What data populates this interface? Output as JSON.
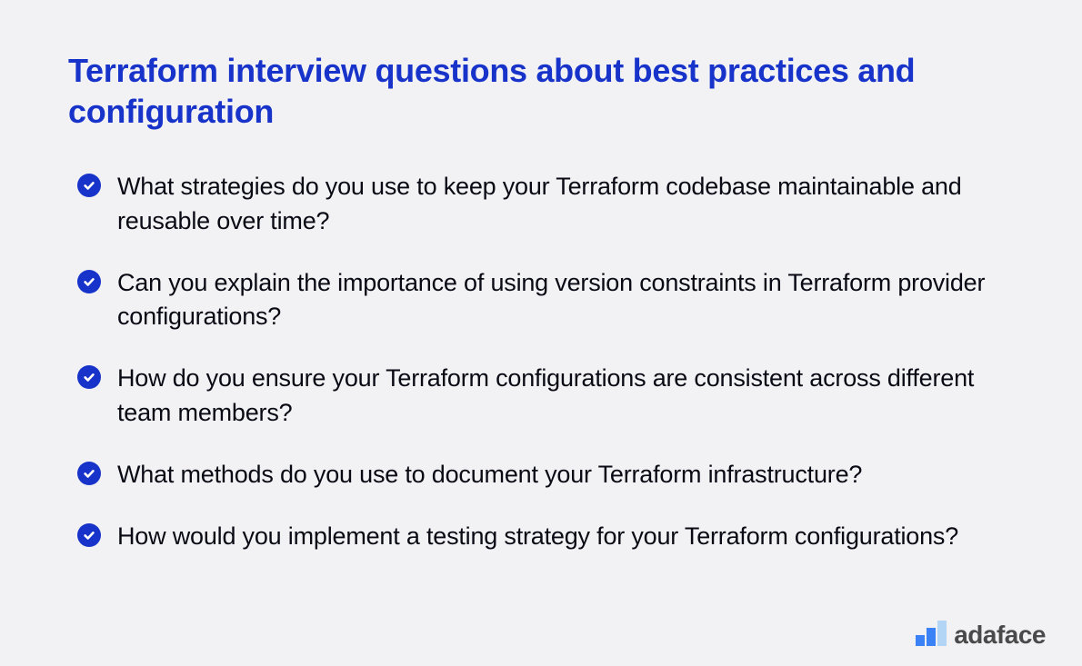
{
  "heading": "Terraform interview questions about best practices and configuration",
  "questions": [
    "What strategies do you use to keep your Terraform codebase maintainable and reusable over time?",
    "Can you explain the importance of using version constraints in Terraform provider configurations?",
    "How do you ensure your Terraform configurations are consistent across different team members?",
    "What methods do you use to document your Terraform infrastructure?",
    "How would you implement a testing strategy for your Terraform configurations?"
  ],
  "logo": {
    "text": "adaface"
  }
}
